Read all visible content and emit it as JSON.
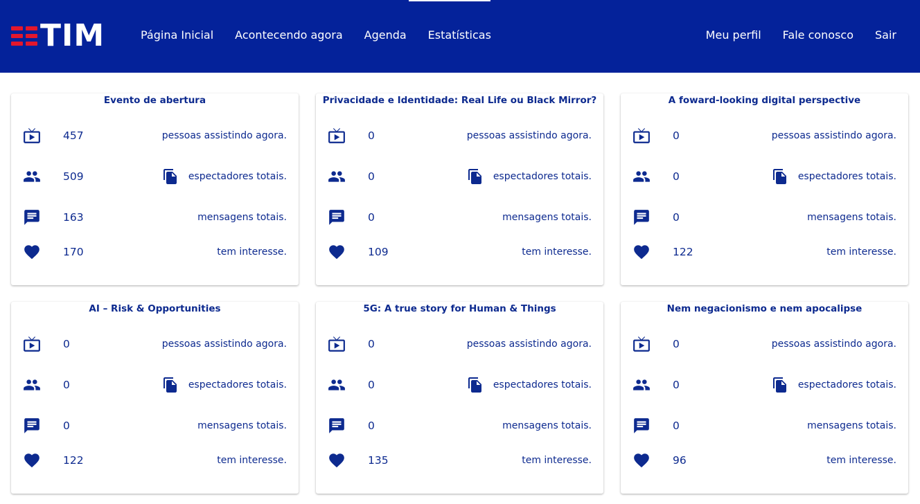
{
  "header": {
    "logo_text": "TIM",
    "nav_left": [
      "Página Inicial",
      "Acontecendo agora",
      "Agenda",
      "Estatísticas"
    ],
    "nav_right": [
      "Meu perfil",
      "Fale conosco",
      "Sair"
    ],
    "active_tab": "Estatísticas"
  },
  "labels": {
    "watching": "pessoas assistindo agora.",
    "viewers": "espectadores totais.",
    "messages": "mensagens totais.",
    "interest": "tem interesse."
  },
  "colors": {
    "brand_blue": "#04229a",
    "text_blue": "#0d2a8f",
    "logo_red": "#e3172c"
  },
  "cards": [
    {
      "title": "Evento de abertura",
      "watching": "457",
      "viewers": "509",
      "messages": "163",
      "interest": "170"
    },
    {
      "title": "Privacidade e Identidade: Real Life ou Black Mirror?",
      "watching": "0",
      "viewers": "0",
      "messages": "0",
      "interest": "109"
    },
    {
      "title": "A foward-looking digital perspective",
      "watching": "0",
      "viewers": "0",
      "messages": "0",
      "interest": "122"
    },
    {
      "title": "AI – Risk & Opportunities",
      "watching": "0",
      "viewers": "0",
      "messages": "0",
      "interest": "122"
    },
    {
      "title": "5G: A true story for Human & Things",
      "watching": "0",
      "viewers": "0",
      "messages": "0",
      "interest": "135"
    },
    {
      "title": "Nem negacionismo e nem apocalipse",
      "watching": "0",
      "viewers": "0",
      "messages": "0",
      "interest": "96"
    }
  ],
  "icons": {
    "watching": "live-tv-icon",
    "viewers": "people-icon",
    "viewers_label": "copy-document-icon",
    "messages": "chat-message-icon",
    "interest": "heart-icon"
  }
}
